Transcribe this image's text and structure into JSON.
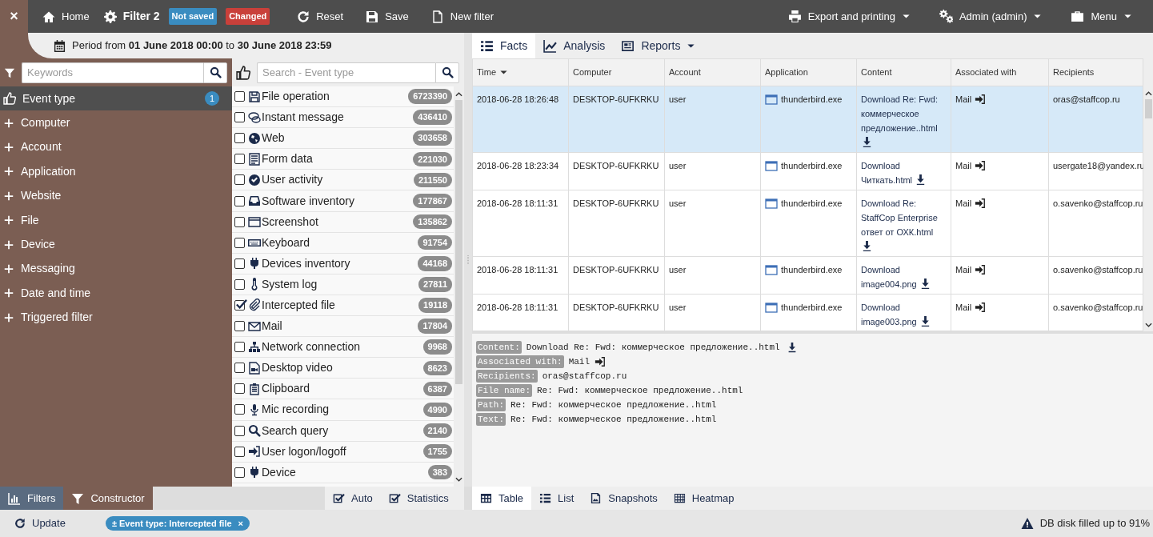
{
  "navbar": {
    "close": "×",
    "home": "Home",
    "filter_name": "Filter 2",
    "badges": [
      {
        "label": "Not saved",
        "color": "#3a8cc0"
      },
      {
        "label": "Changed",
        "color": "#c9403a"
      }
    ],
    "actions": [
      {
        "kind": "reset",
        "label": "Reset"
      },
      {
        "kind": "save",
        "label": "Save"
      },
      {
        "kind": "new",
        "label": "New filter"
      }
    ],
    "menus": [
      {
        "kind": "export",
        "label": "Export and printing"
      },
      {
        "kind": "admin",
        "label": "Admin (admin)"
      },
      {
        "kind": "menu",
        "label": "Menu"
      }
    ]
  },
  "period": "Period from **01 June 2018 00:00** to **30 June 2018 23:59**",
  "sidebar": {
    "placeholder": "Keywords",
    "categories": [
      {
        "label": "Event type",
        "selected": true,
        "count": "1"
      },
      {
        "label": "Computer",
        "selected": false
      },
      {
        "label": "Account",
        "selected": false
      },
      {
        "label": "Application",
        "selected": false
      },
      {
        "label": "Website",
        "selected": false
      },
      {
        "label": "File",
        "selected": false
      },
      {
        "label": "Device",
        "selected": false
      },
      {
        "label": "Messaging",
        "selected": false
      },
      {
        "label": "Date and time",
        "selected": false
      },
      {
        "label": "Triggered filter",
        "selected": false
      }
    ]
  },
  "event_types": {
    "placeholder": "Search - Event type",
    "items": [
      {
        "kind": "file",
        "label": "File operation",
        "count": "6723390",
        "checked": false
      },
      {
        "kind": "chat",
        "label": "Instant message",
        "count": "436410",
        "checked": false
      },
      {
        "kind": "globe",
        "label": "Web",
        "count": "303658",
        "checked": false
      },
      {
        "kind": "form",
        "label": "Form data",
        "count": "221030",
        "checked": false
      },
      {
        "kind": "check",
        "label": "User activity",
        "count": "211550",
        "checked": false
      },
      {
        "kind": "inbox",
        "label": "Software inventory",
        "count": "177867",
        "checked": false
      },
      {
        "kind": "window",
        "label": "Screenshot",
        "count": "135862",
        "checked": false
      },
      {
        "kind": "keyboard",
        "label": "Keyboard",
        "count": "91754",
        "checked": false
      },
      {
        "kind": "plug",
        "label": "Devices inventory",
        "count": "44168",
        "checked": false
      },
      {
        "kind": "thermo",
        "label": "System log",
        "count": "27811",
        "checked": false
      },
      {
        "kind": "clip",
        "label": "Intercepted file",
        "count": "19118",
        "checked": true
      },
      {
        "kind": "mail",
        "label": "Mail",
        "count": "17804",
        "checked": false
      },
      {
        "kind": "sitemap",
        "label": "Network connection",
        "count": "9968",
        "checked": false
      },
      {
        "kind": "video",
        "label": "Desktop video",
        "count": "8623",
        "checked": false
      },
      {
        "kind": "clipboard",
        "label": "Clipboard",
        "count": "6387",
        "checked": false
      },
      {
        "kind": "mic",
        "label": "Mic recording",
        "count": "4990",
        "checked": false
      },
      {
        "kind": "search",
        "label": "Search query",
        "count": "2140",
        "checked": false
      },
      {
        "kind": "signin",
        "label": "User logon/logoff",
        "count": "1755",
        "checked": false
      },
      {
        "kind": "plug",
        "label": "Device",
        "count": "383",
        "checked": false
      }
    ]
  },
  "result_tabs": [
    {
      "kind": "list",
      "label": "Facts",
      "selected": true
    },
    {
      "kind": "chart",
      "label": "Analysis",
      "selected": false
    },
    {
      "kind": "news",
      "label": "Reports",
      "selected": false,
      "dropdown": true
    }
  ],
  "table": {
    "columns": [
      {
        "label": "Time",
        "sorted": true
      },
      {
        "label": "Computer",
        "sorted": false
      },
      {
        "label": "Account",
        "sorted": false
      },
      {
        "label": "Application",
        "sorted": false
      },
      {
        "label": "Content",
        "sorted": false
      },
      {
        "label": "Associated with",
        "sorted": false
      },
      {
        "label": "Recipients",
        "sorted": false
      }
    ],
    "rows": [
      {
        "selected": true,
        "cells": [
          "2018-06-28 18:26:48",
          "DESKTOP-6UFKRKU",
          "user",
          "thunderbird.exe",
          "Download Re: Fwd: коммерческое предложение..html",
          "Mail",
          "oras@staffcop.ru"
        ]
      },
      {
        "selected": false,
        "cells": [
          "2018-06-28 18:23:34",
          "DESKTOP-6UFKRKU",
          "user",
          "thunderbird.exe",
          "Download Читкать.html",
          "Mail",
          "usergate18@yandex.ru"
        ]
      },
      {
        "selected": false,
        "cells": [
          "2018-06-28 18:11:31",
          "DESKTOP-6UFKRKU",
          "user",
          "thunderbird.exe",
          "Download Re: StaffCop Enterprise ответ от ОХК.html",
          "Mail",
          "o.savenko@staffcop.ru"
        ]
      },
      {
        "selected": false,
        "cells": [
          "2018-06-28 18:11:31",
          "DESKTOP-6UFKRKU",
          "user",
          "thunderbird.exe",
          "Download image004.png",
          "Mail",
          "o.savenko@staffcop.ru"
        ]
      },
      {
        "selected": false,
        "cells": [
          "2018-06-28 18:11:31",
          "DESKTOP-6UFKRKU",
          "user",
          "thunderbird.exe",
          "Download image003.png",
          "Mail",
          "o.savenko@staffcop.ru"
        ]
      }
    ]
  },
  "details": [
    {
      "kind": "download",
      "label": "Content:",
      "value": "Download Re: Fwd: коммерческое предложение..html"
    },
    {
      "kind": "link",
      "label": "Associated with:",
      "value": "Mail"
    },
    {
      "kind": "text",
      "label": "Recipients:",
      "value": "oras@staffcop.ru"
    },
    {
      "kind": "text",
      "label": "File name:",
      "value": "Re: Fwd: коммерческое предложение..html"
    },
    {
      "kind": "text",
      "label": "Path:",
      "value": "Re: Fwd: коммерческое предложение..html"
    },
    {
      "kind": "text",
      "label": "Text:",
      "value": "Re: Fwd: коммерческое предложение..html"
    }
  ],
  "panel_tabs": [
    {
      "kind": "bars",
      "label": "Filters",
      "selected": true
    },
    {
      "kind": "funnel",
      "label": "Constructor",
      "selected": false
    }
  ],
  "toggles": [
    {
      "label": "Auto",
      "checked": true
    },
    {
      "label": "Statistics",
      "checked": true
    }
  ],
  "view_tabs": [
    {
      "kind": "table",
      "label": "Table",
      "selected": true
    },
    {
      "kind": "list",
      "label": "List",
      "selected": false
    },
    {
      "kind": "picture",
      "label": "Snapshots",
      "selected": false
    },
    {
      "kind": "grid",
      "label": "Heatmap",
      "selected": false
    }
  ],
  "status": {
    "update": "Update",
    "chip": "± Event type: Intercepted file",
    "chip_close": "×",
    "warning": "DB disk filled up to 91%"
  }
}
